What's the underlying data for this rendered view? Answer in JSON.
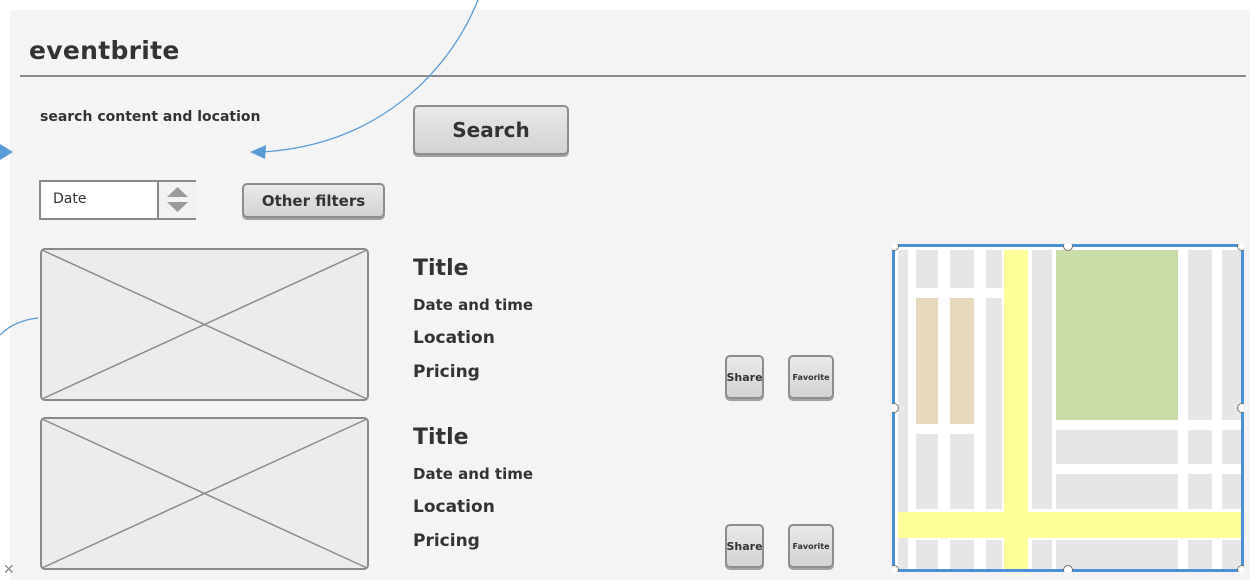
{
  "app": {
    "logo": "eventbrite"
  },
  "search": {
    "label": "search content and location",
    "button_label": "Search"
  },
  "filters": {
    "date_select": {
      "selected": "Date"
    },
    "other_filters_label": "Other filters"
  },
  "listings": [
    {
      "title": "Title",
      "date_time": "Date and time",
      "location": "Location",
      "pricing": "Pricing",
      "share_label": "Share",
      "favorite_label": "Favorite"
    },
    {
      "title": "Title",
      "date_time": "Date and time",
      "location": "Location",
      "pricing": "Pricing",
      "share_label": "Share",
      "favorite_label": "Favorite"
    }
  ],
  "icons": {
    "stepper": "up-down-stepper-icon",
    "image_placeholder": "image-placeholder-icon",
    "close": "close-icon"
  },
  "colors": {
    "annotation_arrow": "#5b9bd5",
    "map_selection": "#4a90d9",
    "map_road_major": "#ffff99",
    "map_park": "#c9dca8",
    "map_area": "#e6d9bd"
  }
}
